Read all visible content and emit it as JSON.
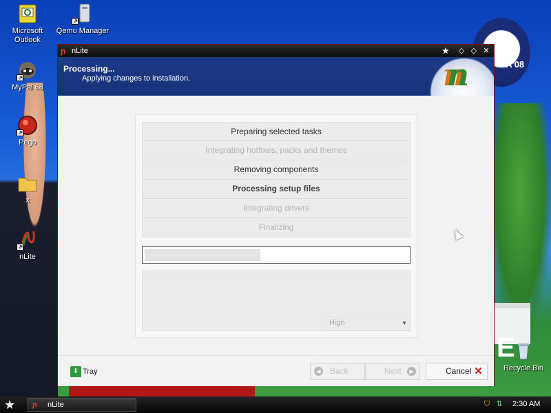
{
  "desktop": {
    "icons": [
      {
        "label": "Microsoft Outlook",
        "icon": "outlook-icon"
      },
      {
        "label": "Qemu Manager",
        "icon": "qemu-manager-icon"
      },
      {
        "label": "MyPal 68",
        "icon": "mypal-icon"
      },
      {
        "label": "Pego",
        "icon": "pego-icon"
      },
      {
        "label": "x",
        "icon": "folder-icon"
      },
      {
        "label": "nLite",
        "icon": "nlite-icon"
      },
      {
        "label": "Recycle Bin",
        "icon": "recycle-bin-icon"
      }
    ],
    "wallpaper_logo_text": "AMA'08"
  },
  "window": {
    "title": "nLite",
    "header": {
      "title": "Processing...",
      "subtitle": "Applying changes to installation."
    },
    "tasks": [
      {
        "label": "Preparing selected tasks",
        "state": "done"
      },
      {
        "label": "Integrating hotfixes, packs and themes",
        "state": "pending"
      },
      {
        "label": "Removing components",
        "state": "done"
      },
      {
        "label": "Processing setup files",
        "state": "active"
      },
      {
        "label": "Integrating drivers",
        "state": "pending"
      },
      {
        "label": "Finalizing",
        "state": "pending"
      }
    ],
    "progress_fraction": 0.44,
    "priority": {
      "selected": "High"
    },
    "footer": {
      "tray_label": "Tray",
      "back_label": "Back",
      "next_label": "Next",
      "cancel_label": "Cancel"
    }
  },
  "taskbar": {
    "task_label": "nLite",
    "clock": "2:30 AM"
  }
}
